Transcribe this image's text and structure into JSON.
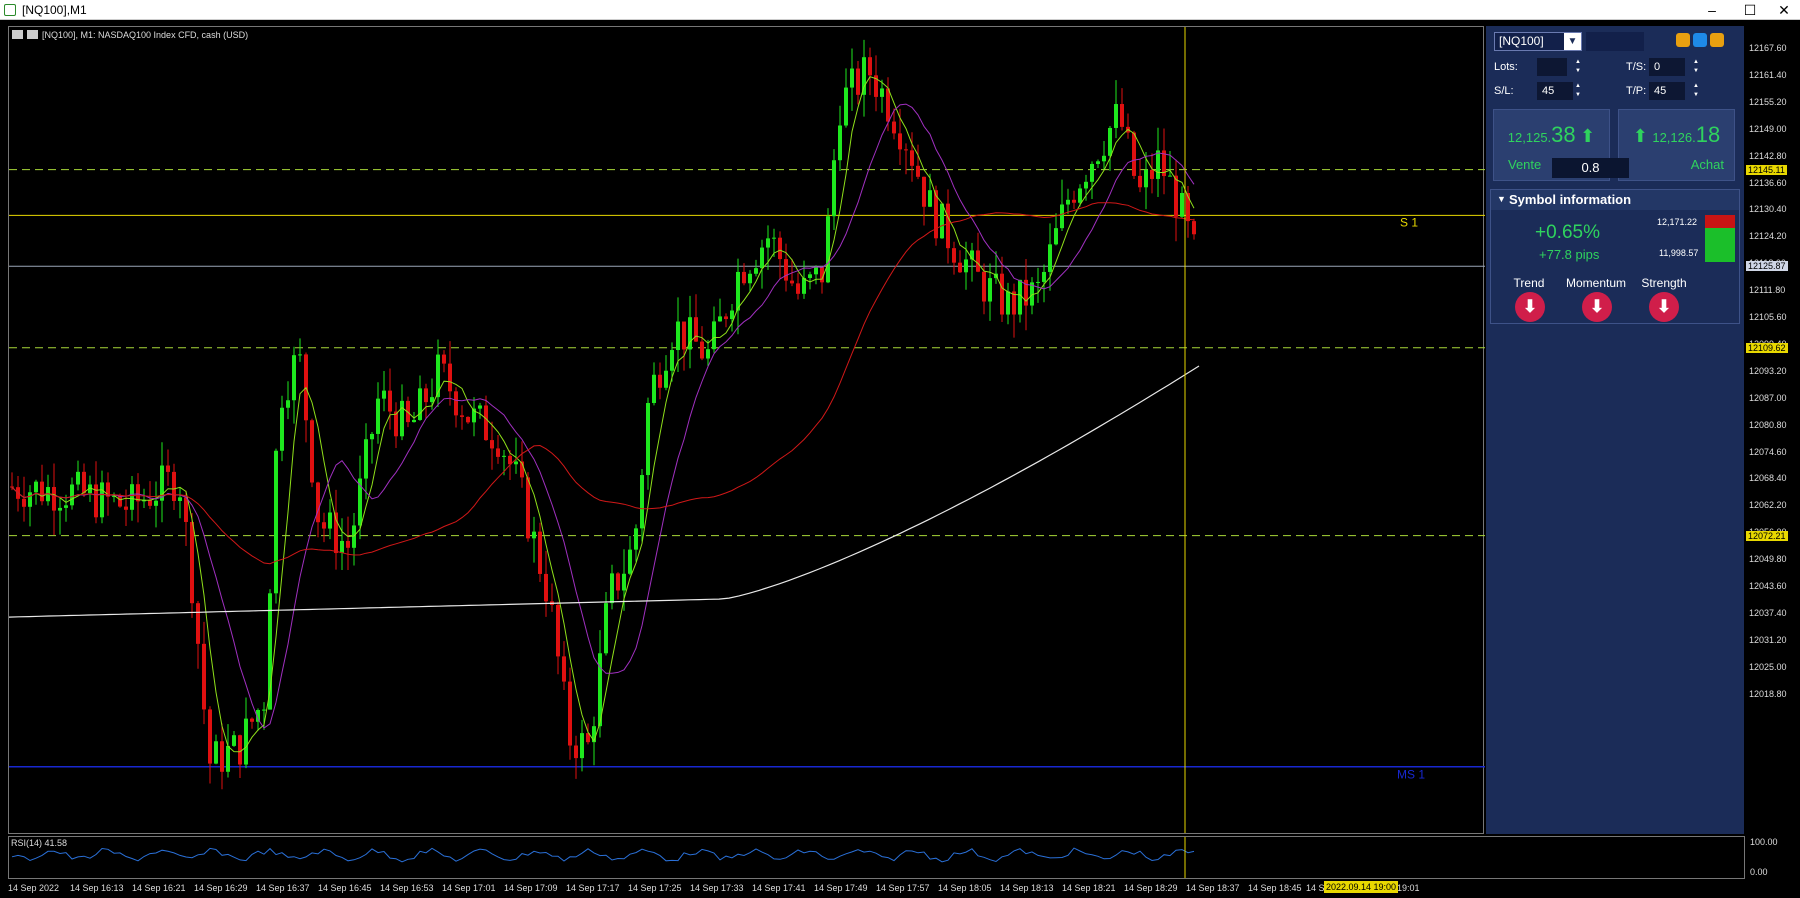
{
  "window": {
    "title": "[NQ100],M1",
    "controls": [
      "–",
      "☐",
      "✕"
    ]
  },
  "chart": {
    "header": "[NQ100], M1:  NASDAQ100 Index CFD, cash (USD)",
    "s1_label": "S 1",
    "ms1_label": "MS 1",
    "price_ticks": [
      "12167.60",
      "12161.40",
      "12155.20",
      "12149.00",
      "12142.80",
      "12136.60",
      "12130.40",
      "12124.20",
      "12118.00",
      "12111.80",
      "12105.60",
      "12099.40",
      "12093.20",
      "12087.00",
      "12080.80",
      "12074.60",
      "12068.40",
      "12062.20",
      "12056.00",
      "12049.80",
      "12043.60",
      "12037.40",
      "12031.20",
      "12025.00",
      "12018.80"
    ],
    "price_tags": [
      {
        "label": "12145.11",
        "color": "#e8d800"
      },
      {
        "label": "12125.87",
        "color": "#cfd6e6"
      },
      {
        "label": "12109.62",
        "color": "#e8d800"
      },
      {
        "label": "12072.21",
        "color": "#e8d800"
      }
    ],
    "price_range": [
      12013.0,
      12173.5
    ],
    "levels": {
      "upper_dash": 12145.11,
      "s1": 12136.0,
      "bid_line": 12125.87,
      "mid_dash": 12109.62,
      "lower_dash": 12072.21,
      "ms1": 12026.2
    }
  },
  "rsi": {
    "label": "RSI(14) 41.58",
    "axis_top": "100.00",
    "axis_bottom": "0.00"
  },
  "time_axis": {
    "labels": [
      "14 Sep 2022",
      "14 Sep 16:13",
      "14 Sep 16:21",
      "14 Sep 16:29",
      "14 Sep 16:37",
      "14 Sep 16:45",
      "14 Sep 16:53",
      "14 Sep 17:01",
      "14 Sep 17:09",
      "14 Sep 17:17",
      "14 Sep 17:25",
      "14 Sep 17:33",
      "14 Sep 17:41",
      "14 Sep 17:49",
      "14 Sep 17:57",
      "14 Sep 18:05",
      "14 Sep 18:13",
      "14 Sep 18:21",
      "14 Sep 18:29",
      "14 Sep 18:37",
      "14 Sep 18:45",
      "14 S",
      "19:01"
    ],
    "cursor_label": "2022.09.14 19:00"
  },
  "panel": {
    "symbol": "[NQ100]",
    "lots_label": "Lots:",
    "lots_value": "",
    "ts_label": "T/S:",
    "ts_value": "0",
    "sl_label": "S/L:",
    "sl_value": "45",
    "tp_label": "T/P:",
    "tp_value": "45",
    "sell": {
      "price_small": "12,125.",
      "price_big": "38",
      "label": "Vente"
    },
    "buy": {
      "price_small": "12,126.",
      "price_big": "18",
      "label": "Achat"
    },
    "spread": "0.8",
    "symbol_info": {
      "title": "Symbol information",
      "change_pct": "+0.65%",
      "change_pips": "+77.8 pips",
      "high": "12,171.22",
      "low": "11,998.57",
      "indicators": [
        "Trend",
        "Momentum",
        "Strength"
      ],
      "colors": {
        "positive": "#2fd35e",
        "signal_down": "#d01e4a"
      }
    }
  },
  "colors": {
    "bull_candle": "#1ee81e",
    "bear_candle": "#e01010",
    "ma_fast": "#8fe01a",
    "ma_mid": "#a030c0",
    "ma_slow": "#d01818",
    "ma_long": "#e8e8e8",
    "level_yellow": "#e8d800",
    "level_blue": "#1828d0"
  }
}
